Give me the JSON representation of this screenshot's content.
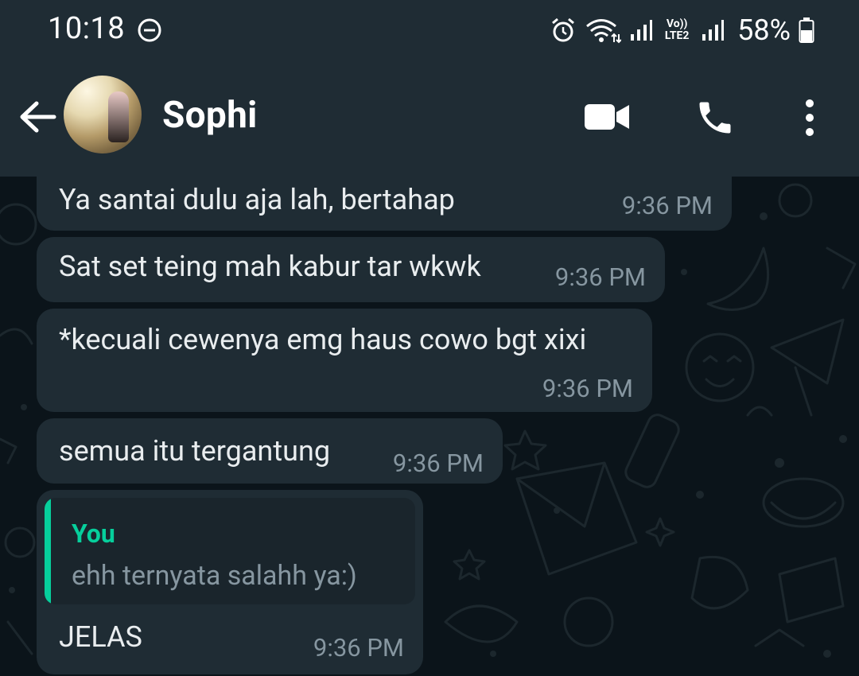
{
  "status_bar": {
    "time": "10:18",
    "volte_top": "Vo))",
    "volte_bottom": "LTE2",
    "battery_percent": "58%"
  },
  "header": {
    "contact_name": "Sophi"
  },
  "messages": [
    {
      "text": "Ya santai dulu aja lah, bertahap",
      "time": "9:36 PM"
    },
    {
      "text": "Sat set teing mah kabur tar wkwk",
      "time": "9:36 PM"
    },
    {
      "text": "*kecuali cewenya emg haus cowo bgt xixi",
      "time": "9:36 PM"
    },
    {
      "text": "semua itu tergantung",
      "time": "9:36 PM"
    },
    {
      "reply_to": {
        "author": "You",
        "text": "ehh ternyata salahh ya:)"
      },
      "text": "JELAS",
      "time": "9:36 PM"
    }
  ],
  "colors": {
    "header_bg": "#1f2c34",
    "chat_bg": "#0b141a",
    "bubble_bg": "#1f2c34",
    "accent": "#06cf9c",
    "timestamp": "#8696a0",
    "text": "#e9edef"
  },
  "icons": {
    "dnd": "do-not-disturb-icon",
    "alarm": "alarm-icon",
    "wifi": "wifi-icon",
    "signal": "signal-icon",
    "battery": "battery-icon",
    "back": "arrow-back-icon",
    "video": "video-camera-icon",
    "call": "phone-icon",
    "menu": "more-vertical-icon"
  }
}
